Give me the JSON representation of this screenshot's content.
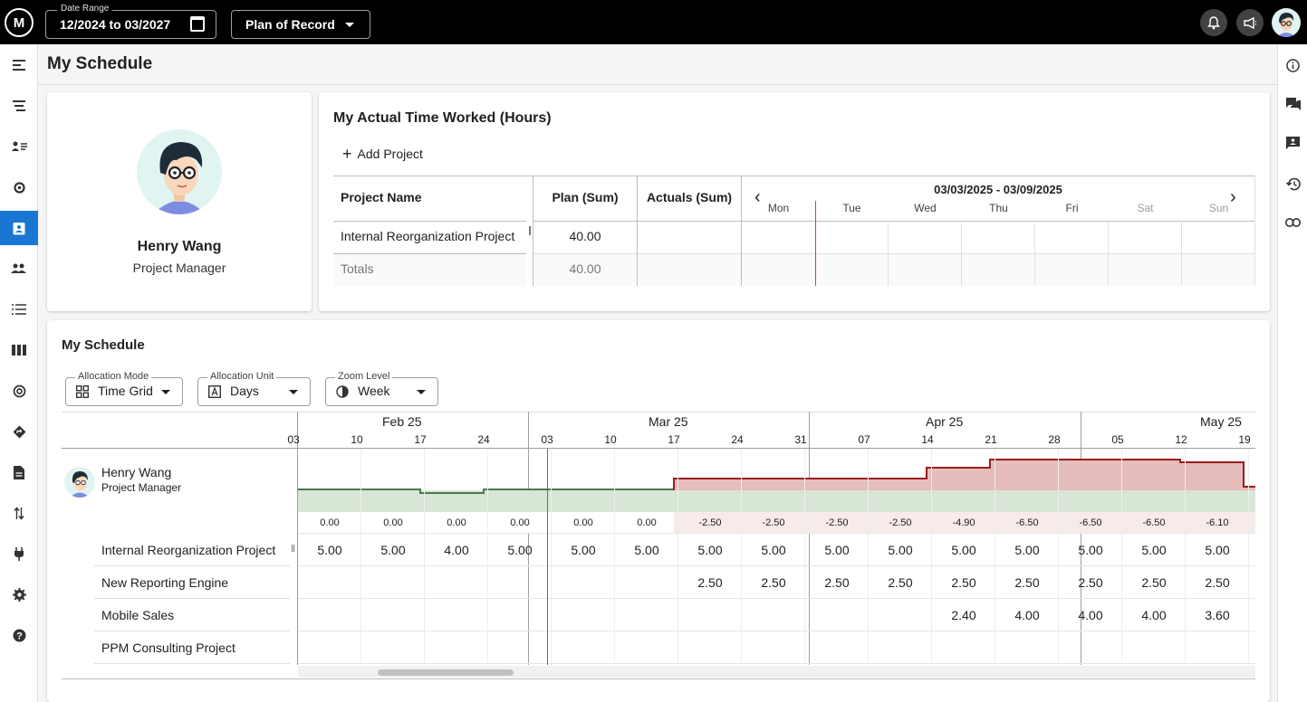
{
  "header": {
    "logo": "M",
    "date_range_label": "Date Range",
    "date_range_value": "12/2024 to 03/2027",
    "scenario": "Plan of Record"
  },
  "page": {
    "title": "My Schedule"
  },
  "profile": {
    "name": "Henry Wang",
    "role": "Project Manager"
  },
  "time_worked": {
    "title": "My Actual Time Worked (Hours)",
    "add_project": "Add Project",
    "columns": {
      "project": "Project Name",
      "plan": "Plan (Sum)",
      "actuals": "Actuals (Sum)"
    },
    "week_range": "03/03/2025 - 03/09/2025",
    "days": [
      "Mon",
      "Tue",
      "Wed",
      "Thu",
      "Fri",
      "Sat",
      "Sun"
    ],
    "rows": [
      {
        "project": "Internal Reorganization Project",
        "plan": "40.00",
        "actuals": ""
      }
    ],
    "totals": {
      "label": "Totals",
      "plan": "40.00"
    }
  },
  "schedule": {
    "title": "My Schedule",
    "allocation_mode": {
      "label": "Allocation Mode",
      "value": "Time Grid"
    },
    "allocation_unit": {
      "label": "Allocation Unit",
      "value": "Days"
    },
    "zoom_level": {
      "label": "Zoom Level",
      "value": "Week"
    },
    "months": [
      "Feb 25",
      "Mar 25",
      "Apr 25",
      "May 25"
    ],
    "weeks": [
      "03",
      "10",
      "17",
      "24",
      "03",
      "10",
      "17",
      "24",
      "31",
      "07",
      "14",
      "21",
      "28",
      "05",
      "12",
      "19"
    ],
    "resource": {
      "name": "Henry Wang",
      "role": "Project Manager"
    },
    "availability": [
      "0.00",
      "0.00",
      "0.00",
      "0.00",
      "0.00",
      "0.00",
      "-2.50",
      "-2.50",
      "-2.50",
      "-2.50",
      "-4.90",
      "-6.50",
      "-6.50",
      "-6.50",
      "-6.10"
    ],
    "projects": [
      {
        "name": "Internal Reorganization Project",
        "values": [
          "5.00",
          "5.00",
          "4.00",
          "5.00",
          "5.00",
          "5.00",
          "5.00",
          "5.00",
          "5.00",
          "5.00",
          "5.00",
          "5.00",
          "5.00",
          "5.00",
          "5.00"
        ]
      },
      {
        "name": "New Reporting Engine",
        "values": [
          "",
          "",
          "",
          "",
          "",
          "",
          "2.50",
          "2.50",
          "2.50",
          "2.50",
          "2.50",
          "2.50",
          "2.50",
          "2.50",
          "2.50"
        ]
      },
      {
        "name": "Mobile Sales",
        "values": [
          "",
          "",
          "",
          "",
          "",
          "",
          "",
          "",
          "",
          "",
          "2.40",
          "4.00",
          "4.00",
          "4.00",
          "3.60"
        ]
      },
      {
        "name": "PPM Consulting Project",
        "values": [
          "",
          "",
          "",
          "",
          "",
          "",
          "",
          "",
          "",
          "",
          "",
          "",
          "",
          "",
          ""
        ]
      }
    ]
  },
  "colors": {
    "accent": "#1976d2",
    "over": "#e6bcbc",
    "over_line": "#9b1c1c",
    "capacity": "#d8e6d5",
    "capacity_line": "#4a7a4f",
    "today": "#e53935"
  }
}
